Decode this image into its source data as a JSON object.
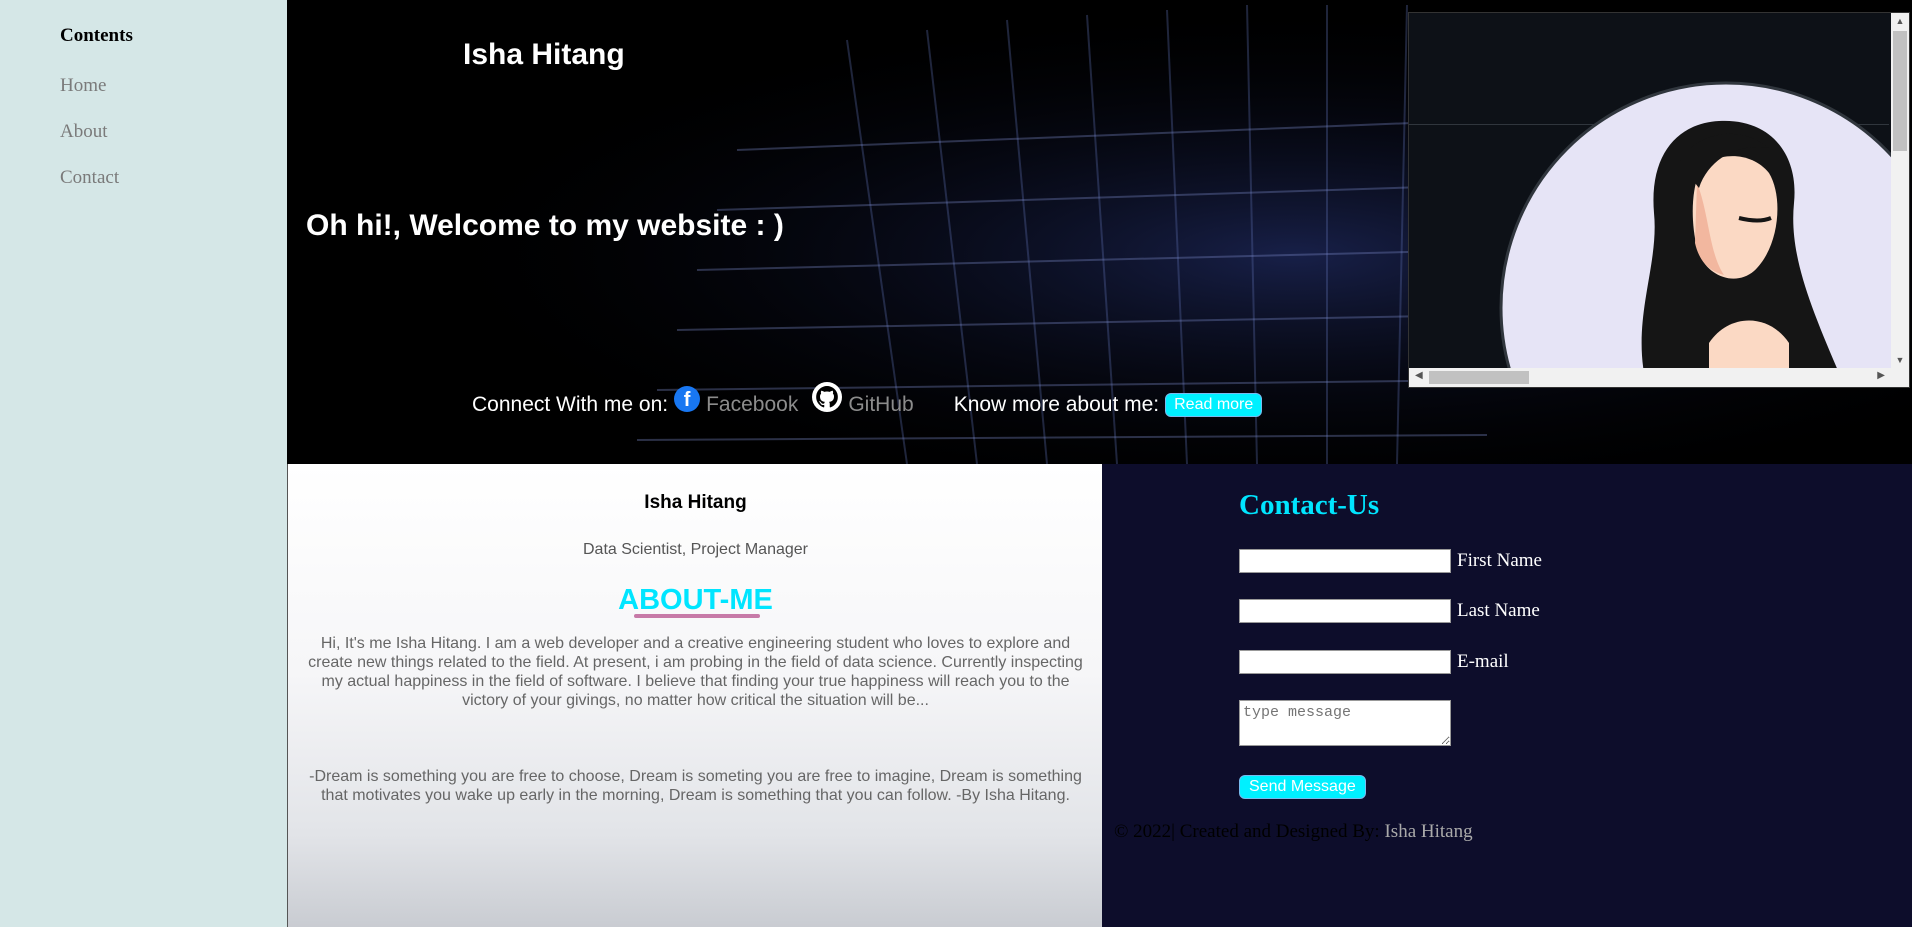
{
  "sidebar": {
    "heading": "Contents",
    "items": [
      {
        "label": "Home"
      },
      {
        "label": "About"
      },
      {
        "label": "Contact"
      }
    ]
  },
  "hero": {
    "name": "Isha Hitang",
    "welcome": "Oh hi!, Welcome to my website : )",
    "connect_label": "Connect With me on:",
    "facebook_label": "Facebook",
    "github_label": "GitHub",
    "know_more_label": "Know more about me:",
    "read_more_label": "Read more"
  },
  "about": {
    "name": "Isha Hitang",
    "role": "Data Scientist, Project Manager",
    "title": "ABOUT-ME",
    "paragraph1": "Hi, It's me Isha Hitang. I am a web developer and a creative engineering student who loves to explore and create new things related to the field. At present, i am probing in the field of data science. Currently inspecting my actual happiness in the field of software. I believe that finding your true happiness will reach you to the victory of your givings, no matter how critical the situation will be...",
    "paragraph2": "-Dream is something you are free to choose, Dream is someting you are free to imagine, Dream is something that motivates you wake up early in the morning, Dream is something that you can follow. -By Isha Hitang."
  },
  "contact": {
    "title": "Contact-Us",
    "first_name_label": "First Name",
    "last_name_label": "Last Name",
    "email_label": "E-mail",
    "message_placeholder": "type message",
    "send_label": "Send Message",
    "footer_text": "© 2022| Created and Designed By:",
    "footer_author": "Isha Hitang"
  },
  "colors": {
    "accent": "#00e5ff",
    "sidebar_bg": "#d5e7e7",
    "contact_bg": "#0d0d2b",
    "title_underline": "#c77aa8"
  }
}
